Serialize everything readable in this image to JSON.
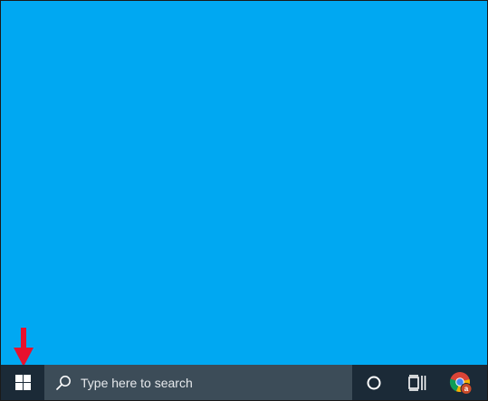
{
  "colors": {
    "desktop_background": "#00a8f2",
    "taskbar_background": "#1b2a37",
    "search_background": "#3c4c58",
    "arrow": "#e8112d"
  },
  "taskbar": {
    "search": {
      "placeholder": "Type here to search",
      "icon": "search-icon"
    },
    "start_icon": "windows-logo-icon",
    "cortana_icon": "cortana-circle-icon",
    "task_view_icon": "task-view-icon",
    "pinned_apps": [
      {
        "name": "chrome",
        "icon": "chrome-icon",
        "badge": "a"
      }
    ]
  },
  "annotation": {
    "icon": "red-arrow-down-icon",
    "points_to": "start-button"
  }
}
